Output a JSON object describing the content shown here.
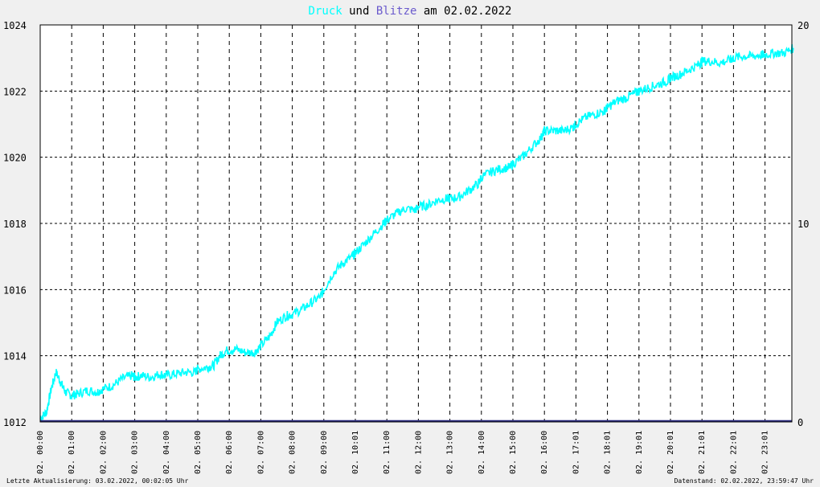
{
  "title": {
    "part1": "Druck",
    "part2": "und",
    "part3": "Blitze",
    "part4": "am 02.02.2022",
    "color_druck": "#00ffff",
    "color_blitze": "#6a5acd"
  },
  "footer": {
    "left": "Letzte Aktualisierung: 03.02.2022, 00:02:05 Uhr",
    "right": "Datenstand: 02.02.2022, 23:59:47 Uhr"
  },
  "chart_data": {
    "type": "line",
    "grid": true,
    "x_labels": [
      "02. 00:00",
      "02. 01:00",
      "02. 02:00",
      "02. 03:00",
      "02. 04:00",
      "02. 05:00",
      "02. 06:00",
      "02. 07:00",
      "02. 08:00",
      "02. 09:00",
      "02. 10:01",
      "02. 11:00",
      "02. 12:00",
      "02. 13:00",
      "02. 14:00",
      "02. 15:00",
      "02. 16:00",
      "02. 17:01",
      "02. 18:01",
      "02. 19:01",
      "02. 20:01",
      "02. 21:01",
      "02. 22:01",
      "02. 23:01"
    ],
    "y_left": {
      "ticks": [
        1012,
        1014,
        1016,
        1018,
        1020,
        1022,
        1024
      ],
      "ylim": [
        1012,
        1024
      ]
    },
    "y_right": {
      "ticks": [
        0,
        10,
        20
      ],
      "ylim": [
        0,
        20
      ]
    },
    "series": [
      {
        "name": "Druck",
        "axis": "left",
        "color": "#00ffff",
        "x_hours": [
          0,
          0.2,
          0.35,
          0.5,
          0.65,
          0.8,
          1.0,
          1.2,
          1.5,
          1.8,
          2.0,
          2.3,
          2.6,
          2.9,
          3.0,
          3.2,
          3.5,
          3.8,
          4.0,
          4.3,
          4.6,
          4.9,
          5.0,
          5.3,
          5.5,
          5.7,
          5.9,
          6.2,
          6.5,
          6.8,
          7.0,
          7.3,
          7.5,
          7.8,
          8.0,
          8.3,
          8.6,
          8.9,
          9.0,
          9.3,
          9.6,
          9.9,
          10.0,
          10.3,
          10.6,
          10.9,
          11.0,
          11.3,
          11.6,
          11.9,
          12.0,
          12.3,
          12.6,
          12.9,
          13.0,
          13.3,
          13.6,
          13.9,
          14.0,
          14.3,
          14.6,
          14.9,
          15.0,
          15.3,
          15.6,
          15.9,
          16.0,
          16.3,
          16.6,
          16.9,
          17.0,
          17.3,
          17.6,
          17.9,
          18.0,
          18.3,
          18.6,
          18.9,
          19.0,
          19.3,
          19.6,
          19.9,
          20.0,
          20.3,
          20.6,
          20.9,
          21.0,
          21.3,
          21.6,
          21.9,
          22.0,
          22.3,
          22.6,
          22.9,
          23.0,
          23.3,
          23.6,
          23.9
        ],
        "values": [
          1012.1,
          1012.3,
          1013.0,
          1013.5,
          1013.2,
          1012.9,
          1012.8,
          1012.85,
          1012.95,
          1012.9,
          1013.0,
          1013.1,
          1013.3,
          1013.4,
          1013.35,
          1013.4,
          1013.35,
          1013.45,
          1013.4,
          1013.45,
          1013.5,
          1013.5,
          1013.6,
          1013.65,
          1013.7,
          1014.0,
          1014.15,
          1014.2,
          1014.1,
          1014.1,
          1014.3,
          1014.6,
          1015.0,
          1015.2,
          1015.25,
          1015.4,
          1015.6,
          1015.8,
          1016.0,
          1016.5,
          1016.8,
          1017.0,
          1017.1,
          1017.4,
          1017.7,
          1018.0,
          1018.1,
          1018.3,
          1018.45,
          1018.4,
          1018.5,
          1018.55,
          1018.7,
          1018.75,
          1018.75,
          1018.8,
          1019.0,
          1019.2,
          1019.4,
          1019.55,
          1019.65,
          1019.7,
          1019.8,
          1020.0,
          1020.3,
          1020.6,
          1020.8,
          1020.8,
          1020.8,
          1020.9,
          1021.0,
          1021.2,
          1021.3,
          1021.4,
          1021.5,
          1021.7,
          1021.8,
          1021.95,
          1022.0,
          1022.1,
          1022.2,
          1022.3,
          1022.4,
          1022.5,
          1022.65,
          1022.8,
          1022.9,
          1022.9,
          1022.85,
          1022.95,
          1023.0,
          1023.05,
          1023.05,
          1023.1,
          1023.1,
          1023.15,
          1023.15,
          1023.3
        ]
      },
      {
        "name": "Blitze",
        "axis": "right",
        "color": "#2b2b80",
        "x_hours": [
          0,
          24
        ],
        "values": [
          0,
          0
        ]
      }
    ]
  }
}
